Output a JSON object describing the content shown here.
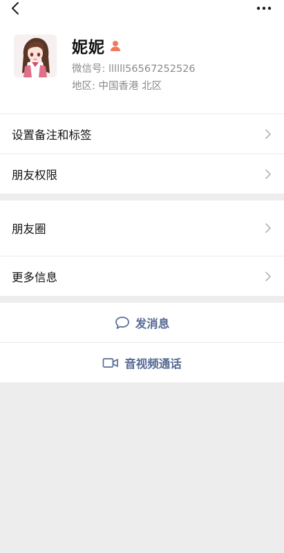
{
  "icons": {
    "back": "chevron-left-icon",
    "more": "more-dots-icon",
    "gender": "female-user-icon",
    "chevron": "chevron-right-icon",
    "message": "chat-bubble-icon",
    "video": "video-camera-icon"
  },
  "colors": {
    "link_blue": "#576b95",
    "gender_icon": "#f07b5a",
    "background": "#ededed"
  },
  "profile": {
    "name": "妮妮",
    "wechat_id": "微信号: llllll56567252526",
    "region": "地区: 中国香港  北区"
  },
  "list1": {
    "remark_tags": "设置备注和标签",
    "friend_permissions": "朋友权限"
  },
  "list2": {
    "moments": "朋友圈",
    "more_info": "更多信息"
  },
  "actions": {
    "send_message": "发消息",
    "video_call": "音视频通话"
  }
}
